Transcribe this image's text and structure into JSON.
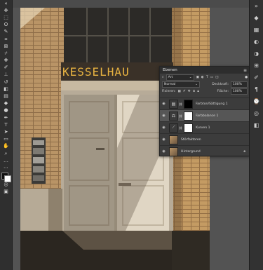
{
  "layers_panel": {
    "title": "Ebenen",
    "filter_kind": "Art",
    "blend_mode": "Normal",
    "opacity_label": "Deckkraft:",
    "opacity_value": "100%",
    "fill_label": "Fläche:",
    "fill_value": "100%",
    "lock_label": "Fixieren:",
    "layers": [
      {
        "name": "Farbton/Sättigung 1"
      },
      {
        "name": "Farbbalance 1"
      },
      {
        "name": "Kurven 1"
      },
      {
        "name": "Störfaktoren"
      },
      {
        "name": "Hintergrund"
      }
    ]
  },
  "canvas": {
    "sign_text": "KESSELHAU"
  }
}
